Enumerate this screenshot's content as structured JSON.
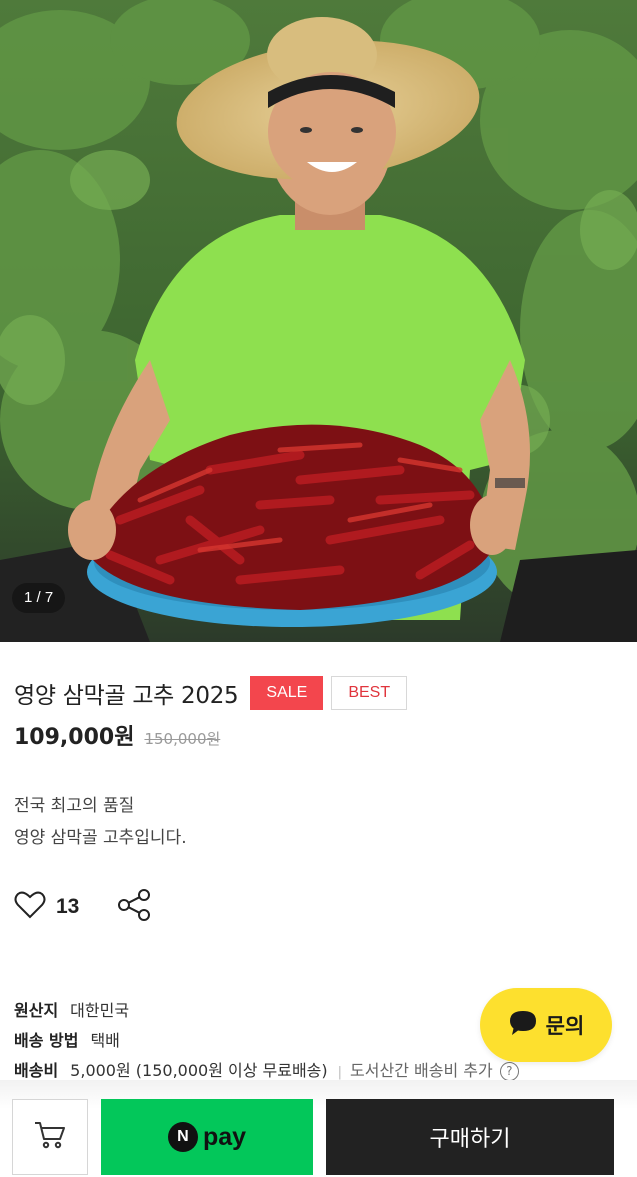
{
  "gallery": {
    "current": "1",
    "total": "7",
    "counter_text": "1 / 7",
    "image_alt": "farmer holding a basket of dried red peppers"
  },
  "product": {
    "title": "영양 삼막골 고추 2025",
    "badges": {
      "sale": "SALE",
      "best": "BEST"
    },
    "price": "109,000원",
    "original_price": "150,000원",
    "description": [
      "전국 최고의 품질",
      "영양 삼막골 고추입니다."
    ]
  },
  "social": {
    "like_count": "13",
    "like_icon": "heart-outline-icon",
    "share_icon": "share-icon"
  },
  "specs": {
    "origin": {
      "key": "원산지",
      "value": "대한민국"
    },
    "delivery_method": {
      "key": "배송 방법",
      "value": "택배"
    },
    "shipping_fee": {
      "key": "배송비",
      "value": "5,000원 (150,000원 이상 무료배송)",
      "separator": "|",
      "extra": "도서산간 배송비 추가",
      "help": "?"
    }
  },
  "inquiry": {
    "label": "문의",
    "icon": "chat-bubble-icon",
    "color": "#fde02e"
  },
  "bottom_bar": {
    "cart_icon": "shopping-cart-icon",
    "npay_logo": "N",
    "npay_label": "pay",
    "buy_label": "구매하기",
    "colors": {
      "npay": "#03c75a",
      "buy": "#222222",
      "sale": "#f3464d"
    }
  }
}
